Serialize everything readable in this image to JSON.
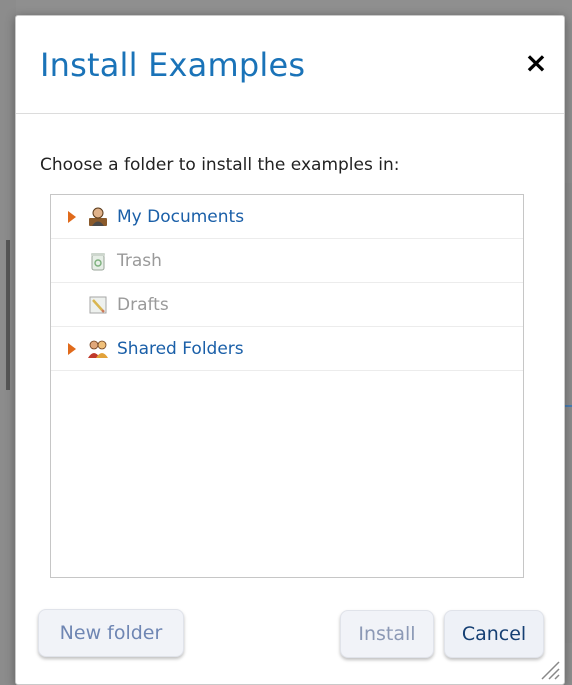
{
  "dialog": {
    "title": "Install Examples",
    "close_label": "×",
    "instruction": "Choose a folder to install the examples in:"
  },
  "tree": {
    "items": [
      {
        "label": "My Documents",
        "icon": "user-folder-icon",
        "expandable": true,
        "enabled": true
      },
      {
        "label": "Trash",
        "icon": "trash-icon",
        "expandable": false,
        "enabled": false
      },
      {
        "label": "Drafts",
        "icon": "drafts-icon",
        "expandable": false,
        "enabled": false
      },
      {
        "label": "Shared Folders",
        "icon": "shared-folder-icon",
        "expandable": true,
        "enabled": true
      }
    ]
  },
  "buttons": {
    "new_folder": "New folder",
    "install": "Install",
    "cancel": "Cancel"
  },
  "colors": {
    "title": "#1a73b8",
    "tree_link": "#1a5fa8",
    "disabled": "#9a9a9a",
    "expand_arrow": "#e06a1b"
  }
}
